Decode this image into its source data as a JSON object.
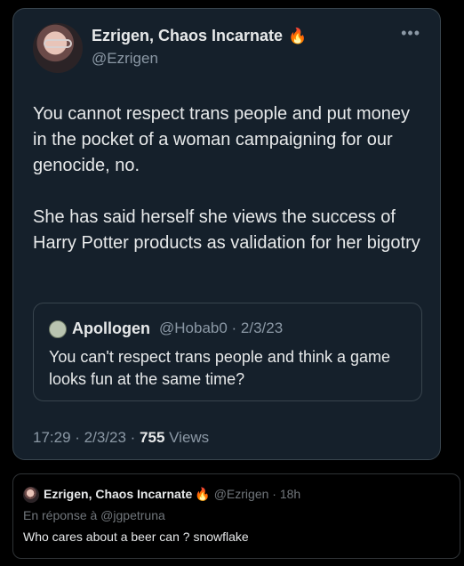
{
  "tweet": {
    "author_name": "Ezrigen, Chaos Incarnate",
    "author_handle": "@Ezrigen",
    "more_icon": "•••",
    "flame_icon": "🔥",
    "paragraphs": [
      "You cannot respect trans people and put money in the pocket of a woman campaigning for our genocide, no.",
      "She has said herself she views the success of Harry Potter products as validation for her bigotry"
    ],
    "quote": {
      "author_name": "Apollogen",
      "handle_date": "@Hobab0 · 2/3/23",
      "text": "You can't respect trans people and think a game looks fun at the same time?"
    },
    "meta_prefix": "17:29 · 2/3/23 · ",
    "views_count": "755",
    "views_label": " Views"
  },
  "reply": {
    "author_name": "Ezrigen, Chaos Incarnate",
    "flame_icon": "🔥",
    "handle_time": "@Ezrigen · 18h",
    "context": "En réponse à @jgpetruna",
    "text": "Who cares about a beer can ? snowflake"
  },
  "colors": {
    "card_background": "#15202b",
    "page_background": "#000000",
    "secondary_text": "#8b98a5",
    "flame": "#ff6a1a"
  }
}
